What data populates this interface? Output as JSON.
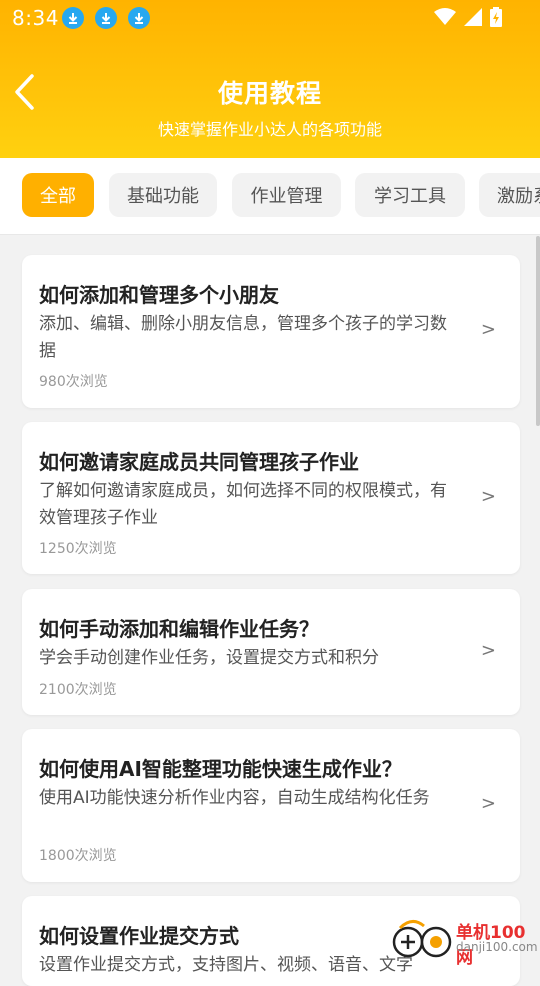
{
  "status_bar": {
    "time": "8:34",
    "icons": [
      "download-icon",
      "download-icon",
      "download-icon",
      "wifi-icon",
      "signal-icon",
      "battery-charging-icon"
    ]
  },
  "header": {
    "title": "使用教程",
    "subtitle": "快速掌握作业小达人的各项功能"
  },
  "tabs": [
    {
      "label": "全部",
      "active": true
    },
    {
      "label": "基础功能",
      "active": false
    },
    {
      "label": "作业管理",
      "active": false
    },
    {
      "label": "学习工具",
      "active": false
    },
    {
      "label": "激励系统",
      "active": false
    }
  ],
  "tutorials": [
    {
      "title": "如何添加和管理多个小朋友",
      "desc": "添加、编辑、删除小朋友信息，管理多个孩子的学习数据",
      "views": "980次浏览"
    },
    {
      "title": "如何邀请家庭成员共同管理孩子作业",
      "desc": "了解如何邀请家庭成员，如何选择不同的权限模式，有效管理孩子作业",
      "views": "1250次浏览"
    },
    {
      "title": "如何手动添加和编辑作业任务？",
      "desc": "学会手动创建作业任务，设置提交方式和积分",
      "views": "2100次浏览"
    },
    {
      "title": "如何使用AI智能整理功能快速生成作业？",
      "desc": "使用AI功能快速分析作业内容，自动生成结构化任务",
      "views": "1800次浏览"
    },
    {
      "title": "如何设置作业提交方式",
      "desc": "设置作业提交方式，支持图片、视频、语音、文字",
      "views": ""
    }
  ],
  "chevron": ">",
  "watermark": {
    "main": "单机100网",
    "sub": "danji100.com"
  },
  "colors": {
    "accent": "#ffb000",
    "header_top": "#ffb300",
    "header_bottom": "#ffd10f"
  }
}
